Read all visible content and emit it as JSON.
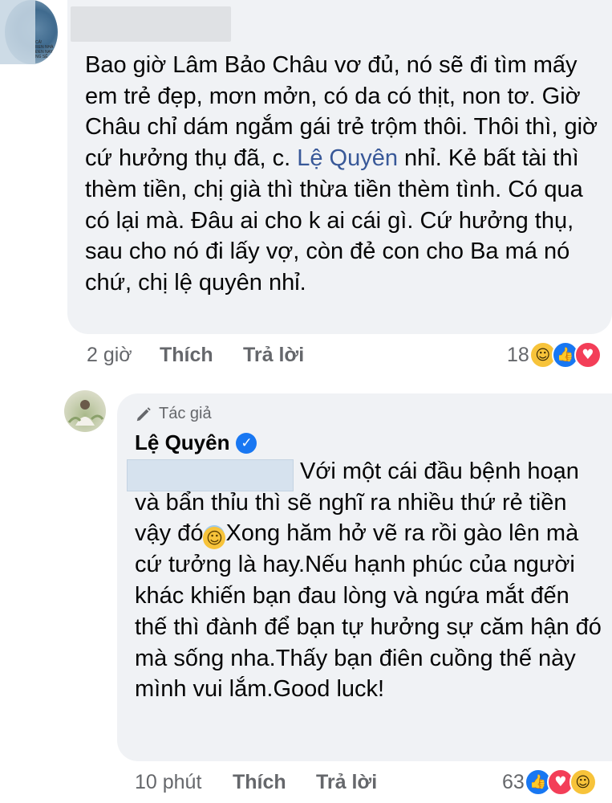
{
  "comment1": {
    "avatar_caption": "CẢ!\nREN NHÀ\nĐEN NAY\nNG SẼ",
    "text_parts": [
      "Bao giờ Lâm Bảo Châu vơ đủ, nó sẽ đi tìm mấy em trẻ đẹp, mơn mởn, có da có thịt, non tơ. Giờ Châu chỉ dám  ngắm gái trẻ trộm thôi. Thôi thì, giờ cứ hưởng thụ đã, c. ",
      "Lệ Quyên",
      " nhỉ. Kẻ bất tài thì thèm tiền, chị già thì thừa tiền thèm tình. Có qua có lại mà. Đâu ai cho k ai cái gì. Cứ hưởng thụ, sau cho nó đi lấy vợ, còn đẻ con cho Ba má nó chứ, chị lệ quyên nhỉ."
    ],
    "time": "2 giờ",
    "like_label": "Thích",
    "reply_label": "Trả lời",
    "reaction_count": "18",
    "reactions": [
      "haha-icon",
      "like-icon",
      "love-icon"
    ]
  },
  "comment2": {
    "author_badge": "Tác giả",
    "author_name": "Lệ Quyên",
    "text_before_emoji": "Với một cái đầu bệnh hoạn và bẩn thỉu thì sẽ nghĩ ra nhiều thứ rẻ tiền vậy đó",
    "text_after_emoji": "Xong hăm hở vẽ ra rồi gào lên mà cứ tưởng là hay.Nếu hạnh phúc của người khác khiến bạn đau lòng và ngứa mắt đến thế thì đành để bạn tự hưởng sự căm hận đó mà sống nha.Thấy bạn điên cuồng thế này mình vui lắm.Good luck!",
    "time": "10 phút",
    "like_label": "Thích",
    "reply_label": "Trả lời",
    "reaction_count": "63",
    "reactions": [
      "like-icon",
      "love-icon",
      "haha-icon"
    ]
  },
  "colors": {
    "bubble": "#f0f2f5",
    "meta_text": "#65676b",
    "mention": "#385898",
    "like_blue": "#1877f2",
    "love_red": "#f33e58",
    "haha_yellow": "#f7c33a"
  }
}
